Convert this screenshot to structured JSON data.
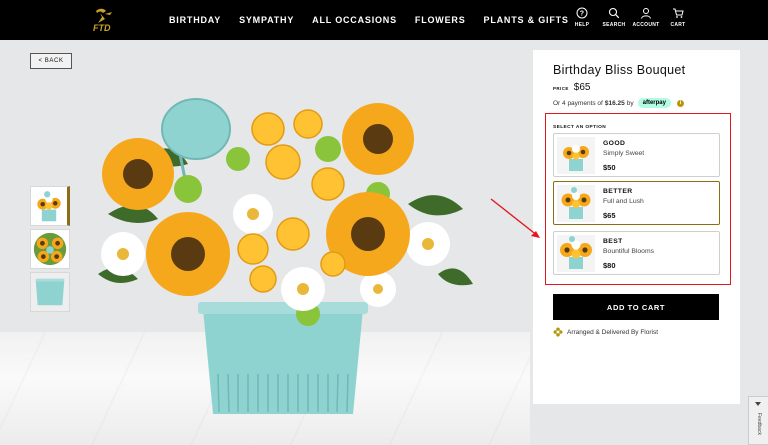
{
  "header": {
    "logo_text": "FTD",
    "nav": [
      "BIRTHDAY",
      "SYMPATHY",
      "ALL OCCASIONS",
      "FLOWERS",
      "PLANTS & GIFTS"
    ],
    "utilities": [
      {
        "label": "HELP",
        "icon": "help-icon"
      },
      {
        "label": "SEARCH",
        "icon": "search-icon"
      },
      {
        "label": "ACCOUNT",
        "icon": "account-icon"
      },
      {
        "label": "CART",
        "icon": "cart-icon"
      }
    ]
  },
  "back_label": "< BACK",
  "product": {
    "title": "Birthday Bliss Bouquet",
    "price_label": "PRICE",
    "price": "$65",
    "afterpay_prefix": "Or 4 payments of",
    "afterpay_amount": "$16.25",
    "afterpay_by": "by",
    "afterpay_brand": "afterpay",
    "select_label": "SELECT AN OPTION",
    "options": [
      {
        "name": "GOOD",
        "desc": "Simply Sweet",
        "price": "$50",
        "selected": false
      },
      {
        "name": "BETTER",
        "desc": "Full and Lush",
        "price": "$65",
        "selected": true
      },
      {
        "name": "BEST",
        "desc": "Bountiful Blooms",
        "price": "$80",
        "selected": false
      }
    ],
    "add_to_cart": "ADD TO CART",
    "florist_note": "Arranged & Delivered By Florist"
  },
  "feedback_label": "Feedback",
  "colors": {
    "header_bg": "#000000",
    "accent_gold": "#8a6d17",
    "afterpay_mint": "#b2fce4",
    "annotation_red": "#e3181f",
    "vase_teal": "#8fd3d1"
  }
}
